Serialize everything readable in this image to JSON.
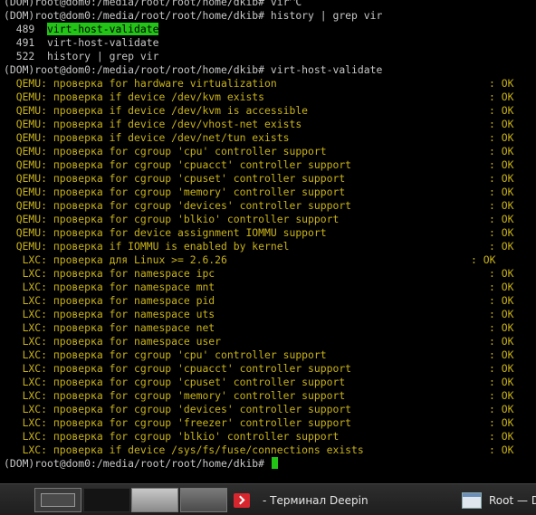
{
  "terminal": {
    "prompt_lines": [
      "(DOM)root@dom0:/media/root/root/home/dkib# vir^C",
      "(DOM)root@dom0:/media/root/root/home/dkib# history | grep vir"
    ],
    "history": [
      {
        "num": "489",
        "cmd": "virt-host-validate"
      },
      {
        "num": "491",
        "cmd": "virt-host-validate"
      },
      {
        "num": "522",
        "cmd": "history | grep vir"
      }
    ],
    "validate_prompt": "(DOM)root@dom0:/media/root/root/home/dkib# virt-host-validate",
    "checks": [
      {
        "text": "  QEMU: проверка for hardware virtualization",
        "result": ": OK"
      },
      {
        "text": "  QEMU: проверка if device /dev/kvm exists",
        "result": ": OK"
      },
      {
        "text": "  QEMU: проверка if device /dev/kvm is accessible",
        "result": ": OK"
      },
      {
        "text": "  QEMU: проверка if device /dev/vhost-net exists",
        "result": ": OK"
      },
      {
        "text": "  QEMU: проверка if device /dev/net/tun exists",
        "result": ": OK"
      },
      {
        "text": "  QEMU: проверка for cgroup 'cpu' controller support",
        "result": ": OK"
      },
      {
        "text": "  QEMU: проверка for cgroup 'cpuacct' controller support",
        "result": ": OK"
      },
      {
        "text": "  QEMU: проверка for cgroup 'cpuset' controller support",
        "result": ": OK"
      },
      {
        "text": "  QEMU: проверка for cgroup 'memory' controller support",
        "result": ": OK"
      },
      {
        "text": "  QEMU: проверка for cgroup 'devices' controller support",
        "result": ": OK"
      },
      {
        "text": "  QEMU: проверка for cgroup 'blkio' controller support",
        "result": ": OK"
      },
      {
        "text": "  QEMU: проверка for device assignment IOMMU support",
        "result": ": OK"
      },
      {
        "text": "  QEMU: проверка if IOMMU is enabled by kernel",
        "result": ": OK"
      },
      {
        "text": "   LXC: проверка для Linux >= 2.6.26",
        "result": ": OK",
        "short": true
      },
      {
        "text": "   LXC: проверка for namespace ipc",
        "result": ": OK"
      },
      {
        "text": "   LXC: проверка for namespace mnt",
        "result": ": OK"
      },
      {
        "text": "   LXC: проверка for namespace pid",
        "result": ": OK"
      },
      {
        "text": "   LXC: проверка for namespace uts",
        "result": ": OK"
      },
      {
        "text": "   LXC: проверка for namespace net",
        "result": ": OK"
      },
      {
        "text": "   LXC: проверка for namespace user",
        "result": ": OK"
      },
      {
        "text": "   LXC: проверка for cgroup 'cpu' controller support",
        "result": ": OK"
      },
      {
        "text": "   LXC: проверка for cgroup 'cpuacct' controller support",
        "result": ": OK"
      },
      {
        "text": "   LXC: проверка for cgroup 'cpuset' controller support",
        "result": ": OK"
      },
      {
        "text": "   LXC: проверка for cgroup 'memory' controller support",
        "result": ": OK"
      },
      {
        "text": "   LXC: проверка for cgroup 'devices' controller support",
        "result": ": OK"
      },
      {
        "text": "   LXC: проверка for cgroup 'freezer' controller support",
        "result": ": OK"
      },
      {
        "text": "   LXC: проверка for cgroup 'blkio' controller support",
        "result": ": OK"
      },
      {
        "text": "   LXC: проверка if device /sys/fs/fuse/connections exists",
        "result": ": OK"
      }
    ],
    "final_prompt": "(DOM)root@dom0:/media/root/root/home/dkib# ",
    "colors": {
      "background": "#000000",
      "text": "#c7c7c7",
      "output": "#c9b217",
      "highlight": "#22c416"
    }
  },
  "taskbar": {
    "tasks": [
      {
        "icon": "terminal-icon",
        "label": "-  Терминал Deepin"
      },
      {
        "icon": "window-icon",
        "label": "Root — D"
      }
    ]
  }
}
